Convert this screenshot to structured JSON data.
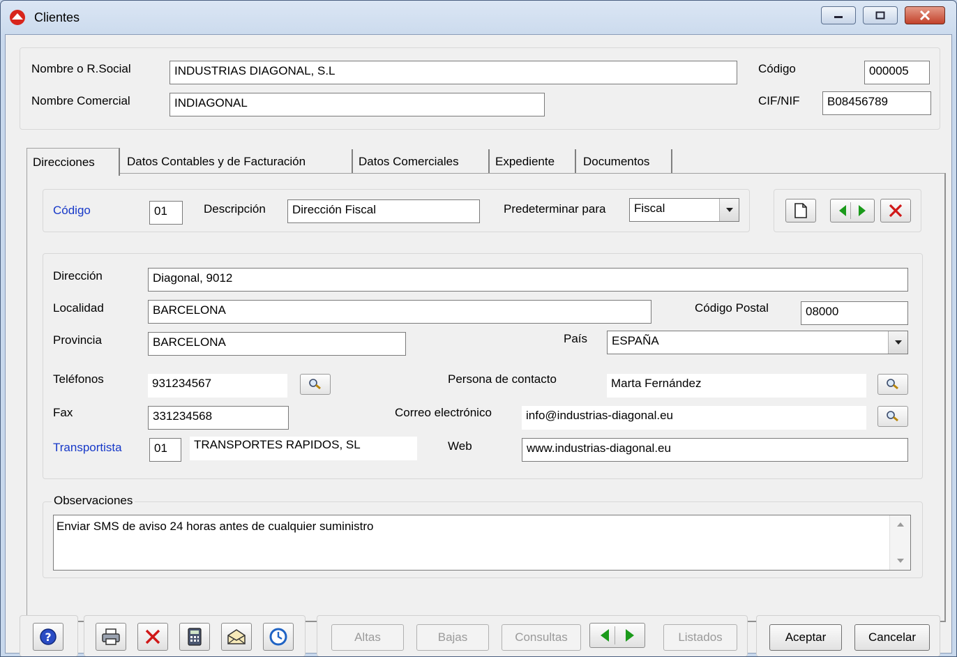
{
  "window": {
    "title": "Clientes"
  },
  "header": {
    "nombre_label": "Nombre o R.Social",
    "nombre_value": "INDUSTRIAS DIAGONAL, S.L",
    "comercial_label": "Nombre Comercial",
    "comercial_value": "INDIAGONAL",
    "codigo_label": "Código",
    "codigo_value": "000005",
    "cif_label": "CIF/NIF",
    "cif_value": "B08456789"
  },
  "tabs": [
    {
      "label": "Direcciones"
    },
    {
      "label": "Datos Contables y de Facturación"
    },
    {
      "label": "Datos Comerciales"
    },
    {
      "label": "Expediente"
    },
    {
      "label": "Documentos"
    }
  ],
  "address_selector": {
    "codigo_label": "Código",
    "codigo_value": "01",
    "descripcion_label": "Descripción",
    "descripcion_value": "Dirección Fiscal",
    "predeterminar_label": "Predeterminar para",
    "predeterminar_value": "Fiscal"
  },
  "address": {
    "direccion_label": "Dirección",
    "direccion_value": "Diagonal, 9012",
    "localidad_label": "Localidad",
    "localidad_value": "BARCELONA",
    "cp_label": "Código Postal",
    "cp_value": "08000",
    "provincia_label": "Provincia",
    "provincia_value": "BARCELONA",
    "pais_label": "País",
    "pais_value": "ESPAÑA",
    "telefonos_label": "Teléfonos",
    "telefonos_value": "931234567",
    "contacto_label": "Persona de contacto",
    "contacto_value": "Marta Fernández",
    "fax_label": "Fax",
    "fax_value": "331234568",
    "correo_label": "Correo electrónico",
    "correo_value": "info@industrias-diagonal.eu",
    "transportista_label": "Transportista",
    "transportista_code": "01",
    "transportista_name": "TRANSPORTES RAPIDOS, SL",
    "web_label": "Web",
    "web_value": "www.industrias-diagonal.eu"
  },
  "observaciones": {
    "label": "Observaciones",
    "text": "Enviar SMS de aviso 24 horas antes de cualquier suministro"
  },
  "footer": {
    "altas": "Altas",
    "bajas": "Bajas",
    "consultas": "Consultas",
    "listados": "Listados",
    "aceptar": "Aceptar",
    "cancelar": "Cancelar"
  },
  "colors": {
    "link_blue": "#1638c8",
    "nav_green": "#1a9a1a",
    "delete_red": "#d01818"
  },
  "icons": [
    "app-icon",
    "minimize-icon",
    "maximize-icon",
    "close-icon",
    "new-document-icon",
    "prev-arrow-icon",
    "next-arrow-icon",
    "delete-icon",
    "search-icon",
    "help-icon",
    "print-icon",
    "calculator-icon",
    "email-icon",
    "clock-icon"
  ]
}
